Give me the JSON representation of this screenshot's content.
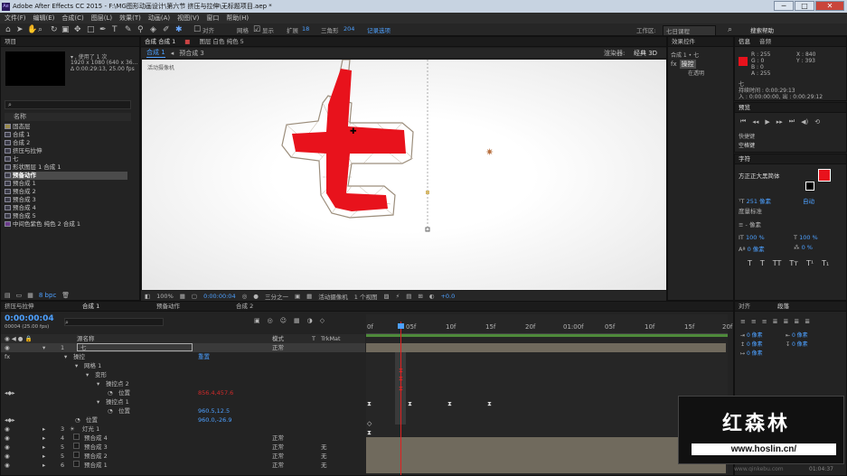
{
  "window": {
    "title": "Adobe After Effects CC 2015 - F:\\MG图形动画设计\\第六节 挤压与拉伸\\无标题项目.aep *",
    "min": "─",
    "max": "□",
    "close": "✕"
  },
  "menu": [
    "文件(F)",
    "编辑(E)",
    "合成(C)",
    "图层(L)",
    "效果(T)",
    "动画(A)",
    "视图(V)",
    "窗口",
    "帮助(H)"
  ],
  "toolbar": {
    "snap": "对齐",
    "show_label": "显示",
    "expand_label": "扩展",
    "expand_val": "18",
    "tri_label": "三角形",
    "tri_val": "204",
    "record": "记录选项",
    "workspace_label": "工作区:",
    "workspace": "七日课程",
    "search": "搜索帮助"
  },
  "project": {
    "tab": "项目",
    "info_line1": "▾ , 使用了 1 次",
    "info_line2": "1920 x 1080 (640 x 36...",
    "info_line3": "Δ 0:00:29:13, 25.00 fps",
    "col_name": "名称",
    "bpc": "8 bpc",
    "items": [
      "固态层",
      "合成 1",
      "合成 2",
      "挤压与拉伸",
      "七",
      "形状图层 1 合成 1",
      "预备动作",
      "预合成 1",
      "预合成 2",
      "预合成 3",
      "预合成 4",
      "预合成 5",
      "中间色紫色 纯色 2 合成 1"
    ]
  },
  "comp": {
    "tab_label": "合成 合成 1",
    "layer_tab": "图层 白色 纯色 5",
    "flow1": "合成 1",
    "flow2": "预合成 3",
    "renderer_label": "渲染器:",
    "renderer": "经典 3D",
    "camera_label": "活动摄像机",
    "zoom": "100%",
    "time": "0:00:00:04",
    "res": "三分之一",
    "camera": "活动摄像机",
    "views": "1 个视图",
    "exposure": "+0.0"
  },
  "effects": {
    "tab": "效果控件",
    "title": "合成 1 • 七",
    "fx": "fx",
    "item": "操控",
    "item2": "在透明"
  },
  "info": {
    "tab1": "信息",
    "tab2": "音频",
    "r": "R : 255",
    "g": "G : 0",
    "b": "B : 0",
    "a": "A : 255",
    "x": "X : 840",
    "y": "Y : 393",
    "name": "七",
    "dur": "持续时间 : 0:00:29:13",
    "in": "入 : 0:00:00:00, 出 : 0:00:29:12"
  },
  "preview": {
    "tab": "预览",
    "shortcut_label": "快捷键",
    "shortcut": "空格键"
  },
  "character": {
    "tab": "字符",
    "font": "方正正大黑简体",
    "size": "251 像素",
    "auto": "自动",
    "tracking": "度量标准",
    "px1": "- 像素",
    "scale1": "100 %",
    "scale2": "100 %",
    "px2": "0 像素",
    "pct": "0 %"
  },
  "align": {
    "tab1": "对齐",
    "tab2": "段落",
    "px_a": "0 像素",
    "px_b": "0 像素",
    "px_c": "0 像素",
    "px_d": "0 像素",
    "px_e": "0 像素"
  },
  "timeline": {
    "tab1": "挤压与拉伸",
    "tab2": "合成 1",
    "tab3": "预备动作",
    "tab4": "合成 2",
    "timecode": "0:00:00:04",
    "fps": "00004 (25.00 fps)",
    "col_src": "源名称",
    "col_mode": "模式",
    "col_t": "T",
    "col_trk": "TrkMat",
    "ruler": [
      "0f",
      "05f",
      "10f",
      "15f",
      "20f",
      "01:00f",
      "05f",
      "10f",
      "15f",
      "20f"
    ],
    "rows": [
      {
        "num": "1",
        "name": "七",
        "mode": "正常",
        "lvl": 0
      },
      {
        "num": "",
        "name": "操控",
        "mode": "",
        "lvl": 1,
        "extra": "重置"
      },
      {
        "num": "",
        "name": "网格 1",
        "mode": "",
        "lvl": 2
      },
      {
        "num": "",
        "name": "变形",
        "mode": "",
        "lvl": 3
      },
      {
        "num": "",
        "name": "操控点 2",
        "mode": "",
        "lvl": 4
      },
      {
        "num": "",
        "name": "位置",
        "mode": "",
        "lvl": 5,
        "val": "856.4,457.6"
      },
      {
        "num": "",
        "name": "操控点 1",
        "mode": "",
        "lvl": 4
      },
      {
        "num": "",
        "name": "位置",
        "mode": "",
        "lvl": 5,
        "val": "960.5,12.5"
      },
      {
        "num": "",
        "name": "位置",
        "mode": "",
        "lvl": 2,
        "val": "960.0,-26.9"
      },
      {
        "num": "3",
        "name": "灯光 1",
        "mode": "",
        "lvl": 0
      },
      {
        "num": "4",
        "name": "预合成 4",
        "mode": "正常",
        "lvl": 0
      },
      {
        "num": "5",
        "name": "预合成 3",
        "mode": "正常",
        "lvl": 0,
        "trk": "无"
      },
      {
        "num": "5",
        "name": "预合成 2",
        "mode": "正常",
        "lvl": 0,
        "trk": "无"
      },
      {
        "num": "6",
        "name": "预合成 1",
        "mode": "正常",
        "lvl": 0,
        "trk": "无"
      }
    ]
  },
  "watermark": {
    "cn": "红森林",
    "url": "www.hoslin.cn/",
    "bottom": "www.qinkebu.com",
    "time": "01:04:37"
  }
}
